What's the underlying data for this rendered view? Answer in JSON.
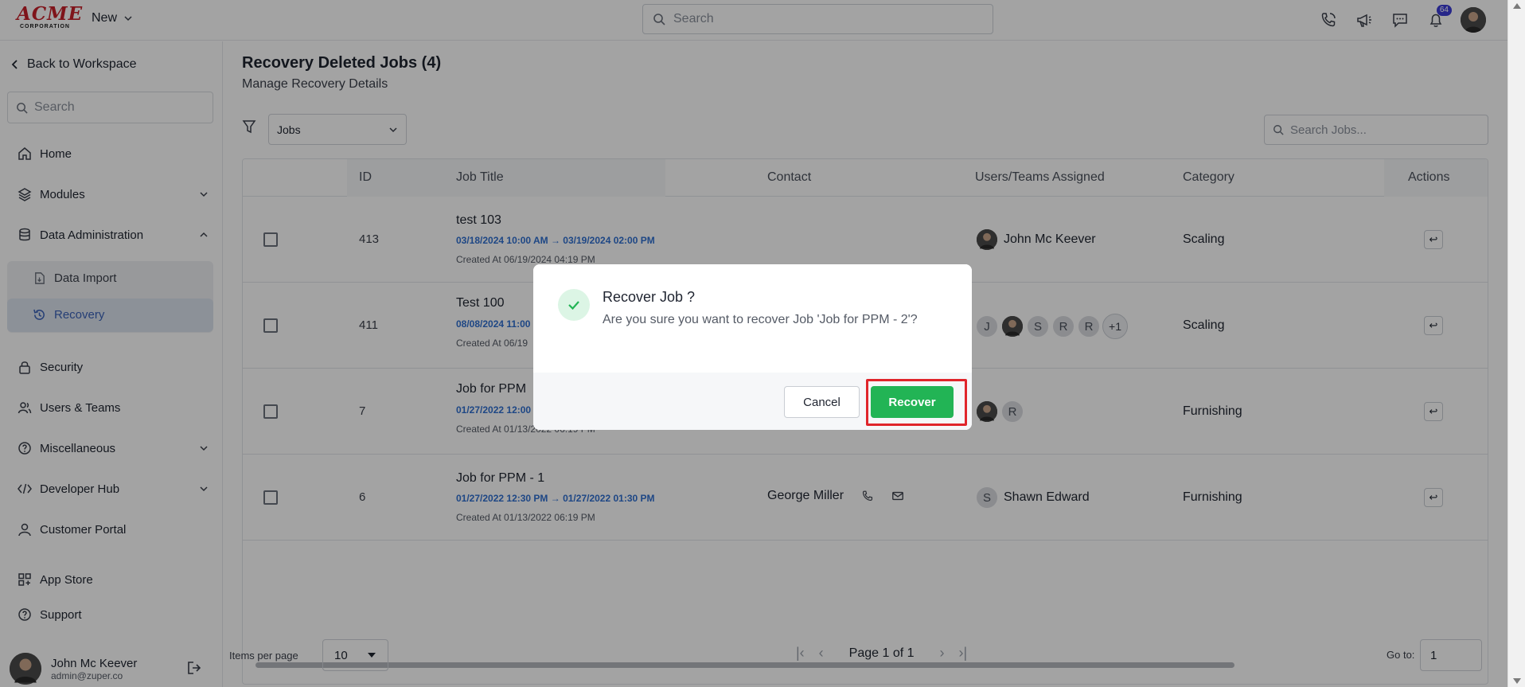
{
  "brand": {
    "logo_text": "ACME",
    "logo_sub": "CORPORATION"
  },
  "topbar": {
    "new_label": "New",
    "search_placeholder": "Search",
    "notifications_count": "64"
  },
  "sidebar": {
    "back_label": "Back to Workspace",
    "search_placeholder": "Search",
    "items": [
      {
        "label": "Home"
      },
      {
        "label": "Modules"
      },
      {
        "label": "Data Administration"
      },
      {
        "label": "Security"
      },
      {
        "label": "Users & Teams"
      },
      {
        "label": "Miscellaneous"
      },
      {
        "label": "Developer Hub"
      },
      {
        "label": "Customer Portal"
      },
      {
        "label": "App Store"
      },
      {
        "label": "Support"
      }
    ],
    "sub_items": [
      {
        "label": "Data Import"
      },
      {
        "label": "Recovery"
      }
    ],
    "user": {
      "name": "John Mc Keever",
      "email": "admin@zuper.co"
    }
  },
  "page": {
    "title": "Recovery Deleted Jobs (4)",
    "subtitle": "Manage Recovery Details",
    "type_select": "Jobs",
    "search_placeholder": "Search Jobs..."
  },
  "table": {
    "columns": [
      "ID",
      "Job Title",
      "Contact",
      "Users/Teams Assigned",
      "Category",
      "Actions"
    ],
    "rows": [
      {
        "id": "413",
        "title": "test 103",
        "dates": "03/18/2024 10:00 AM → 03/19/2024 02:00 PM",
        "created": "Created At 06/19/2024 04:19 PM",
        "contact": "",
        "assigned_name": "John Mc Keever",
        "category": "Scaling"
      },
      {
        "id": "411",
        "title": "Test 100",
        "dates": "08/08/2024 11:00",
        "created": "Created At 06/19",
        "contact": "",
        "assigned_initials": [
          "J",
          "S",
          "R",
          "R"
        ],
        "assigned_more": "+1",
        "category": "Scaling"
      },
      {
        "id": "7",
        "title": "Job for PPM",
        "dates": "01/27/2022 12:00",
        "created": "Created At 01/13/2022 06:19 PM",
        "contact": "",
        "assigned_initials": [
          "R"
        ],
        "category": "Furnishing"
      },
      {
        "id": "6",
        "title": "Job for PPM - 1",
        "dates": "01/27/2022 12:30 PM → 01/27/2022 01:30 PM",
        "created": "Created At 01/13/2022 06:19 PM",
        "contact": "George Miller",
        "assigned_initials": [
          "S"
        ],
        "assigned_name": "Shawn Edward",
        "category": "Furnishing"
      }
    ]
  },
  "pagination": {
    "items_per_page_label": "Items per page",
    "items_per_page": "10",
    "page_text": "Page 1 of 1",
    "goto_label": "Go to:",
    "goto_value": "1"
  },
  "modal": {
    "title": "Recover Job ?",
    "message": "Are you sure you want to recover Job 'Job for PPM - 2'?",
    "cancel_label": "Cancel",
    "confirm_label": "Recover",
    "accent_color": "#22b455",
    "highlight_color": "#e0252b"
  }
}
